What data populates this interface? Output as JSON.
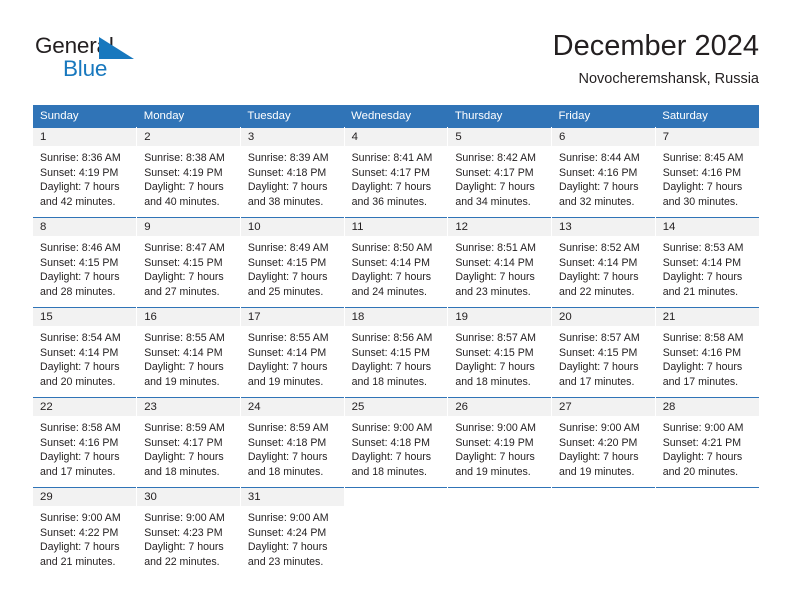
{
  "brand": {
    "name_part1": "General",
    "name_part2": "Blue",
    "triangle_color": "#1878be"
  },
  "header": {
    "title": "December 2024",
    "subtitle": "Novocheremshansk, Russia"
  },
  "theme": {
    "header_bg": "#3074b7",
    "daynum_bg": "#f2f2f2",
    "text": "#231f20"
  },
  "weekday_headers": [
    "Sunday",
    "Monday",
    "Tuesday",
    "Wednesday",
    "Thursday",
    "Friday",
    "Saturday"
  ],
  "weeks": [
    [
      {
        "day": "1",
        "sunrise": "Sunrise: 8:36 AM",
        "sunset": "Sunset: 4:19 PM",
        "daylight_line1": "Daylight: 7 hours",
        "daylight_line2": "and 42 minutes."
      },
      {
        "day": "2",
        "sunrise": "Sunrise: 8:38 AM",
        "sunset": "Sunset: 4:19 PM",
        "daylight_line1": "Daylight: 7 hours",
        "daylight_line2": "and 40 minutes."
      },
      {
        "day": "3",
        "sunrise": "Sunrise: 8:39 AM",
        "sunset": "Sunset: 4:18 PM",
        "daylight_line1": "Daylight: 7 hours",
        "daylight_line2": "and 38 minutes."
      },
      {
        "day": "4",
        "sunrise": "Sunrise: 8:41 AM",
        "sunset": "Sunset: 4:17 PM",
        "daylight_line1": "Daylight: 7 hours",
        "daylight_line2": "and 36 minutes."
      },
      {
        "day": "5",
        "sunrise": "Sunrise: 8:42 AM",
        "sunset": "Sunset: 4:17 PM",
        "daylight_line1": "Daylight: 7 hours",
        "daylight_line2": "and 34 minutes."
      },
      {
        "day": "6",
        "sunrise": "Sunrise: 8:44 AM",
        "sunset": "Sunset: 4:16 PM",
        "daylight_line1": "Daylight: 7 hours",
        "daylight_line2": "and 32 minutes."
      },
      {
        "day": "7",
        "sunrise": "Sunrise: 8:45 AM",
        "sunset": "Sunset: 4:16 PM",
        "daylight_line1": "Daylight: 7 hours",
        "daylight_line2": "and 30 minutes."
      }
    ],
    [
      {
        "day": "8",
        "sunrise": "Sunrise: 8:46 AM",
        "sunset": "Sunset: 4:15 PM",
        "daylight_line1": "Daylight: 7 hours",
        "daylight_line2": "and 28 minutes."
      },
      {
        "day": "9",
        "sunrise": "Sunrise: 8:47 AM",
        "sunset": "Sunset: 4:15 PM",
        "daylight_line1": "Daylight: 7 hours",
        "daylight_line2": "and 27 minutes."
      },
      {
        "day": "10",
        "sunrise": "Sunrise: 8:49 AM",
        "sunset": "Sunset: 4:15 PM",
        "daylight_line1": "Daylight: 7 hours",
        "daylight_line2": "and 25 minutes."
      },
      {
        "day": "11",
        "sunrise": "Sunrise: 8:50 AM",
        "sunset": "Sunset: 4:14 PM",
        "daylight_line1": "Daylight: 7 hours",
        "daylight_line2": "and 24 minutes."
      },
      {
        "day": "12",
        "sunrise": "Sunrise: 8:51 AM",
        "sunset": "Sunset: 4:14 PM",
        "daylight_line1": "Daylight: 7 hours",
        "daylight_line2": "and 23 minutes."
      },
      {
        "day": "13",
        "sunrise": "Sunrise: 8:52 AM",
        "sunset": "Sunset: 4:14 PM",
        "daylight_line1": "Daylight: 7 hours",
        "daylight_line2": "and 22 minutes."
      },
      {
        "day": "14",
        "sunrise": "Sunrise: 8:53 AM",
        "sunset": "Sunset: 4:14 PM",
        "daylight_line1": "Daylight: 7 hours",
        "daylight_line2": "and 21 minutes."
      }
    ],
    [
      {
        "day": "15",
        "sunrise": "Sunrise: 8:54 AM",
        "sunset": "Sunset: 4:14 PM",
        "daylight_line1": "Daylight: 7 hours",
        "daylight_line2": "and 20 minutes."
      },
      {
        "day": "16",
        "sunrise": "Sunrise: 8:55 AM",
        "sunset": "Sunset: 4:14 PM",
        "daylight_line1": "Daylight: 7 hours",
        "daylight_line2": "and 19 minutes."
      },
      {
        "day": "17",
        "sunrise": "Sunrise: 8:55 AM",
        "sunset": "Sunset: 4:14 PM",
        "daylight_line1": "Daylight: 7 hours",
        "daylight_line2": "and 19 minutes."
      },
      {
        "day": "18",
        "sunrise": "Sunrise: 8:56 AM",
        "sunset": "Sunset: 4:15 PM",
        "daylight_line1": "Daylight: 7 hours",
        "daylight_line2": "and 18 minutes."
      },
      {
        "day": "19",
        "sunrise": "Sunrise: 8:57 AM",
        "sunset": "Sunset: 4:15 PM",
        "daylight_line1": "Daylight: 7 hours",
        "daylight_line2": "and 18 minutes."
      },
      {
        "day": "20",
        "sunrise": "Sunrise: 8:57 AM",
        "sunset": "Sunset: 4:15 PM",
        "daylight_line1": "Daylight: 7 hours",
        "daylight_line2": "and 17 minutes."
      },
      {
        "day": "21",
        "sunrise": "Sunrise: 8:58 AM",
        "sunset": "Sunset: 4:16 PM",
        "daylight_line1": "Daylight: 7 hours",
        "daylight_line2": "and 17 minutes."
      }
    ],
    [
      {
        "day": "22",
        "sunrise": "Sunrise: 8:58 AM",
        "sunset": "Sunset: 4:16 PM",
        "daylight_line1": "Daylight: 7 hours",
        "daylight_line2": "and 17 minutes."
      },
      {
        "day": "23",
        "sunrise": "Sunrise: 8:59 AM",
        "sunset": "Sunset: 4:17 PM",
        "daylight_line1": "Daylight: 7 hours",
        "daylight_line2": "and 18 minutes."
      },
      {
        "day": "24",
        "sunrise": "Sunrise: 8:59 AM",
        "sunset": "Sunset: 4:18 PM",
        "daylight_line1": "Daylight: 7 hours",
        "daylight_line2": "and 18 minutes."
      },
      {
        "day": "25",
        "sunrise": "Sunrise: 9:00 AM",
        "sunset": "Sunset: 4:18 PM",
        "daylight_line1": "Daylight: 7 hours",
        "daylight_line2": "and 18 minutes."
      },
      {
        "day": "26",
        "sunrise": "Sunrise: 9:00 AM",
        "sunset": "Sunset: 4:19 PM",
        "daylight_line1": "Daylight: 7 hours",
        "daylight_line2": "and 19 minutes."
      },
      {
        "day": "27",
        "sunrise": "Sunrise: 9:00 AM",
        "sunset": "Sunset: 4:20 PM",
        "daylight_line1": "Daylight: 7 hours",
        "daylight_line2": "and 19 minutes."
      },
      {
        "day": "28",
        "sunrise": "Sunrise: 9:00 AM",
        "sunset": "Sunset: 4:21 PM",
        "daylight_line1": "Daylight: 7 hours",
        "daylight_line2": "and 20 minutes."
      }
    ],
    [
      {
        "day": "29",
        "sunrise": "Sunrise: 9:00 AM",
        "sunset": "Sunset: 4:22 PM",
        "daylight_line1": "Daylight: 7 hours",
        "daylight_line2": "and 21 minutes."
      },
      {
        "day": "30",
        "sunrise": "Sunrise: 9:00 AM",
        "sunset": "Sunset: 4:23 PM",
        "daylight_line1": "Daylight: 7 hours",
        "daylight_line2": "and 22 minutes."
      },
      {
        "day": "31",
        "sunrise": "Sunrise: 9:00 AM",
        "sunset": "Sunset: 4:24 PM",
        "daylight_line1": "Daylight: 7 hours",
        "daylight_line2": "and 23 minutes."
      },
      null,
      null,
      null,
      null
    ]
  ]
}
